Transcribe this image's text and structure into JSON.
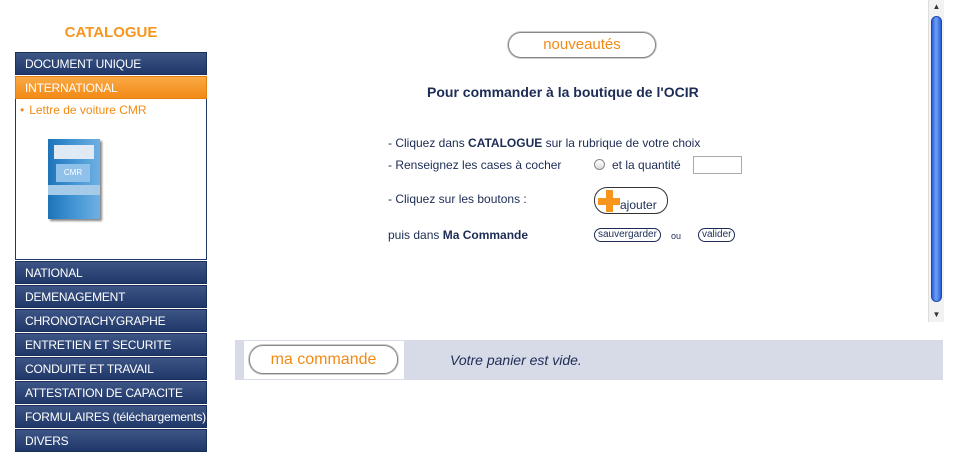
{
  "sidebar": {
    "title": "CATALOGUE",
    "items": [
      {
        "label": "DOCUMENT UNIQUE",
        "active": false
      },
      {
        "label": "INTERNATIONAL",
        "active": true
      },
      {
        "label": "NATIONAL",
        "active": false
      },
      {
        "label": "DEMENAGEMENT",
        "active": false
      },
      {
        "label": "CHRONOTACHYGRAPHE",
        "active": false
      },
      {
        "label": "ENTRETIEN ET SECURITE",
        "active": false
      },
      {
        "label": "CONDUITE ET TRAVAIL",
        "active": false
      },
      {
        "label": "ATTESTATION DE CAPACITE",
        "active": false
      },
      {
        "label": "FORMULAIRES (téléchargements)",
        "active": false
      },
      {
        "label": "DIVERS",
        "active": false
      }
    ],
    "submenu": {
      "bullet": "•",
      "link": "Lettre de voiture CMR",
      "book_label": "CMR"
    }
  },
  "main": {
    "nouveautes_label": "nouveautés",
    "heading": "Pour commander à la boutique de l'OCIR",
    "instr1_prefix": "- Cliquez dans ",
    "instr1_bold": "CATALOGUE",
    "instr1_suffix": " sur la rubrique de votre choix",
    "instr2_label": "- Renseignez les cases à cocher",
    "instr2_qty": "et la quantité",
    "qty_value": "",
    "instr3": "- Cliquez sur les boutons :",
    "ajouter_label": "ajouter",
    "instr4_prefix": "puis dans ",
    "instr4_bold": "Ma Commande",
    "sauvegarder_label": "sauvergarder",
    "ou": "ou",
    "valider_label": "valider"
  },
  "cart": {
    "button_label": "ma commande",
    "status": "Votre panier est vide."
  },
  "scrollbar": {
    "up_glyph": "▲",
    "down_glyph": "▼"
  },
  "colors": {
    "accent": "#f7951d",
    "navy": "#203869",
    "text": "#1d2c55",
    "cart_bar": "#d7dbe8"
  }
}
